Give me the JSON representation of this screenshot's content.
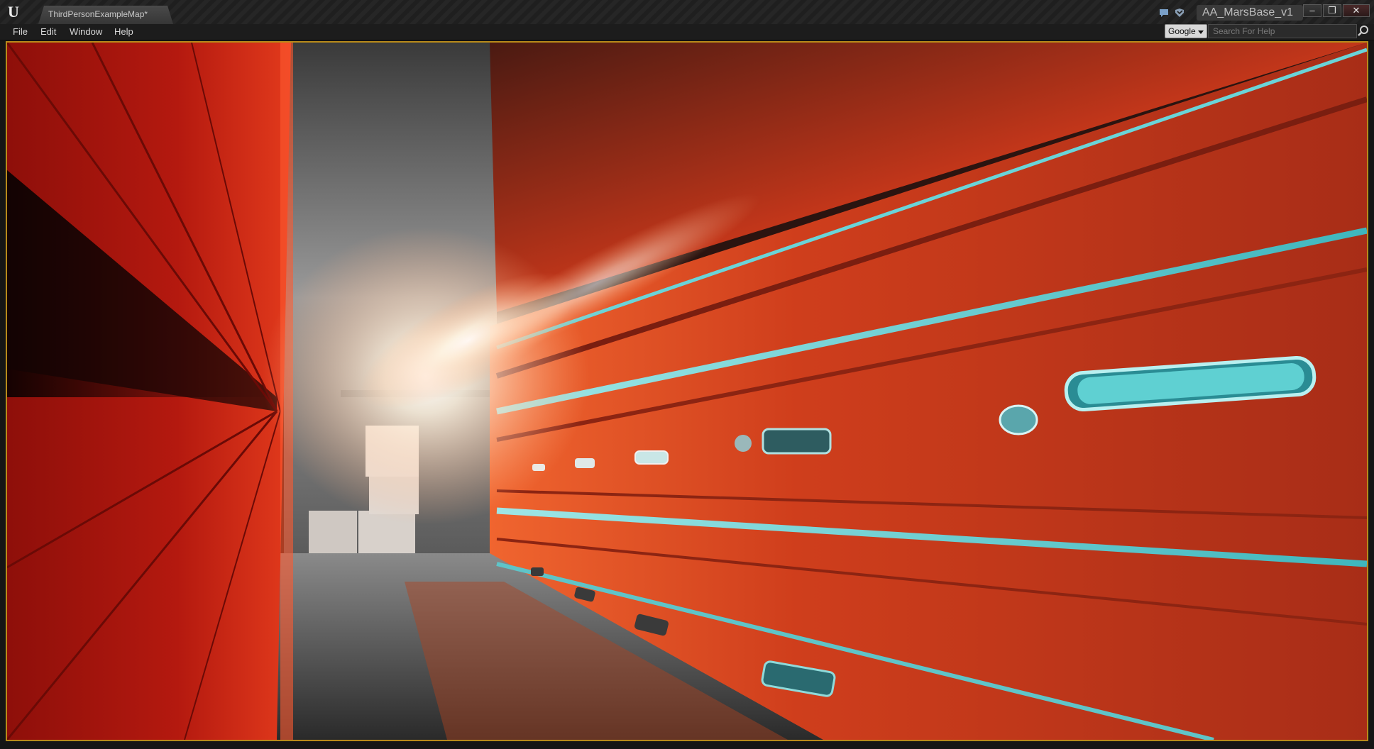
{
  "window": {
    "document_tab": "ThirdPersonExampleMap*",
    "project_name": "AA_MarsBase_v1",
    "controls": {
      "minimize": "–",
      "restore": "❐",
      "close": "✕"
    }
  },
  "menu": {
    "items": [
      "File",
      "Edit",
      "Window",
      "Help"
    ],
    "search_engine": "Google",
    "search_placeholder": "Search For Help"
  },
  "icons": {
    "app": "unreal-engine-logo",
    "notifications": "speech-bubble-icon",
    "source_control": "source-control-icon",
    "search": "magnifier-icon"
  },
  "colors": {
    "accent": "#b88a1a",
    "wall_red": "#c2361a",
    "trim_cyan": "#5fd0d2",
    "light": "#ffffff"
  }
}
